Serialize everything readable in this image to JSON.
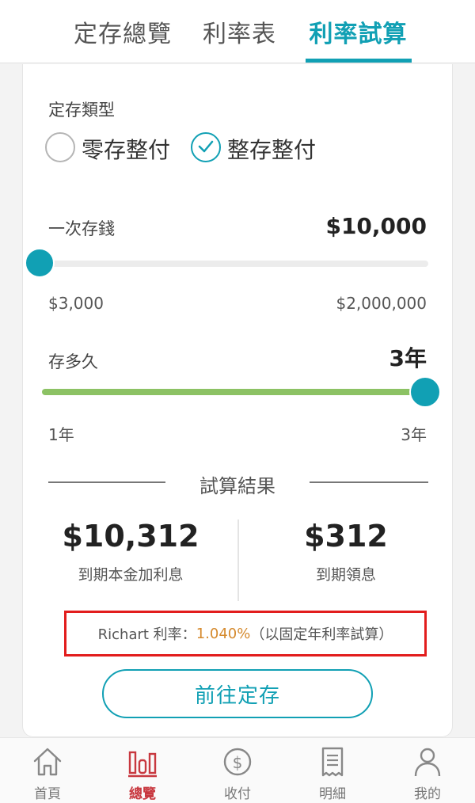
{
  "tabs": [
    {
      "label": "定存總覽",
      "active": false
    },
    {
      "label": "利率表",
      "active": false
    },
    {
      "label": "利率試算",
      "active": true
    }
  ],
  "deposit_type": {
    "label": "定存類型",
    "options": [
      {
        "label": "零存整付",
        "selected": false
      },
      {
        "label": "整存整付",
        "selected": true
      }
    ]
  },
  "amount": {
    "label": "一次存錢",
    "value": "$10,000",
    "min": "$3,000",
    "max": "$2,000,000",
    "position": 0
  },
  "duration": {
    "label": "存多久",
    "value": "3年",
    "min": "1年",
    "max": "3年",
    "position": 1
  },
  "result": {
    "title": "試算結果",
    "total": "$10,312",
    "total_caption": "到期本金加利息",
    "interest": "$312",
    "interest_caption": "到期領息"
  },
  "rate": {
    "prefix": "Richart 利率：",
    "value": "1.040%",
    "suffix": "（以固定年利率試算）"
  },
  "cta_label": "前往定存",
  "bottom_nav": [
    {
      "label": "首頁",
      "icon": "home-icon",
      "active": false
    },
    {
      "label": "總覽",
      "icon": "overview-chart-icon",
      "active": true
    },
    {
      "label": "收付",
      "icon": "dollar-circle-icon",
      "active": false
    },
    {
      "label": "明細",
      "icon": "receipt-icon",
      "active": false
    },
    {
      "label": "我的",
      "icon": "person-icon",
      "active": false
    }
  ],
  "colors": {
    "accent": "#11a0b4",
    "progress": "#8cc264",
    "highlight_box": "#e21d1d",
    "rate_value": "#d58a2e",
    "nav_active": "#c8383f"
  }
}
